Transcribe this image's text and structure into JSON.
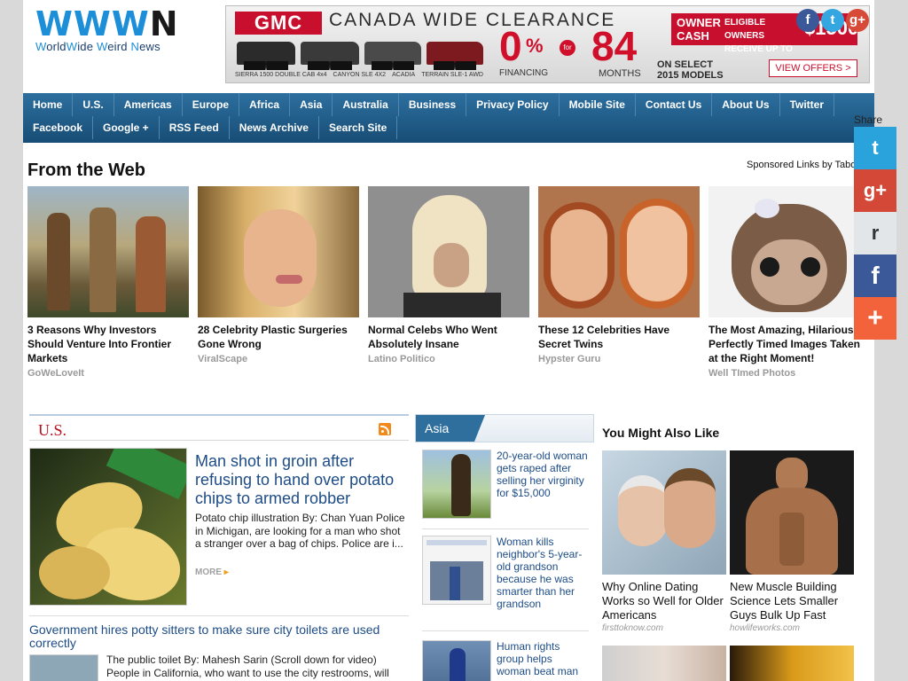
{
  "logo": {
    "mark": "WWW",
    "mark_n": "N",
    "tagline_words": [
      "W",
      "orld",
      "W",
      "ide ",
      "W",
      "eird ",
      "N",
      "ews"
    ],
    "tagline": "WorldWide Weird News"
  },
  "ad": {
    "brand": "GMC",
    "headline": "CANADA WIDE CLEARANCE",
    "models": [
      "SIERRA 1500 DOUBLE CAB 4x4",
      "CANYON SLE 4X2",
      "ACADIA",
      "TERRAIN SLE-1 AWD"
    ],
    "rate": "0",
    "rate_unit": "%",
    "financing": "FINANCING",
    "for": "for",
    "months_num": "84",
    "months": "MONTHS",
    "owner_cash": "OWNER CASH",
    "eligible": "ELIGIBLE OWNERS RECEIVE UP TO",
    "amount": "$1500",
    "on_select": "ON SELECT",
    "model_year": "2015 MODELS",
    "cta": "VIEW OFFERS >"
  },
  "header_social": {
    "facebook": "f",
    "twitter": "t",
    "googleplus": "g+"
  },
  "nav": {
    "row1": [
      "Home",
      "U.S.",
      "Americas",
      "Europe",
      "Africa",
      "Asia",
      "Australia",
      "Business",
      "Privacy Policy",
      "Mobile Site",
      "Contact Us",
      "About Us",
      "Twitter"
    ],
    "row2": [
      "Facebook",
      "Google +",
      "RSS Feed",
      "News Archive",
      "Search Site"
    ]
  },
  "from_the_web": {
    "title": "From the Web",
    "sponsored": "Sponsored Links by Taboola",
    "cards": [
      {
        "caption": "3 Reasons Why Investors Should Venture Into Frontier Markets",
        "source": "GoWeLoveIt"
      },
      {
        "caption": "28 Celebrity Plastic Surgeries Gone Wrong",
        "source": "ViralScape"
      },
      {
        "caption": "Normal Celebs Who Went Absolutely Insane",
        "source": "Latino Politico"
      },
      {
        "caption": "These 12 Celebrities Have Secret Twins",
        "source": "Hypster Guru"
      },
      {
        "caption": "The Most Amazing, Hilarious, Perfectly Timed Images Taken at the Right Moment!",
        "source": "Well TImed Photos"
      }
    ]
  },
  "us_section": {
    "title": "U.S.",
    "story1": {
      "headline": "Man shot in groin after refusing to hand over potato chips to armed robber",
      "body": "Potato chip illustration By: Chan Yuan Police in Michigan, are looking for a man who shot a stranger over a bag of chips. Police are i...",
      "more": "MORE"
    },
    "story2": {
      "headline": "Government hires potty sitters to make sure city toilets are used correctly",
      "body": "The public toilet By: Mahesh Sarin (Scroll down for video) People in California, who want to use the city restrooms, will"
    }
  },
  "asia_section": {
    "title": "Asia",
    "items": [
      {
        "text": "20-year-old woman gets raped after selling her virginity for $15,000"
      },
      {
        "text": "Woman kills neighbor's 5-year-old grandson because he was smarter than her grandson"
      },
      {
        "text": "Human rights group helps woman beat man"
      }
    ]
  },
  "ymal": {
    "title": "You Might Also Like",
    "cards": [
      {
        "caption": "Why Online Dating Works so Well for Older Americans",
        "source": "firsttoknow.com"
      },
      {
        "caption": "New Muscle Building Science Lets Smaller Guys Bulk Up Fast",
        "source": "howlifeworks.com"
      }
    ]
  },
  "share": {
    "label": "Share",
    "twitter": "t",
    "googleplus": "g+",
    "reddit": "r",
    "facebook": "f",
    "more": "+"
  },
  "colors": {
    "brand_blue": "#1d8ed8",
    "nav_blue": "#1f5f8e",
    "link_blue": "#1d4c86",
    "us_red": "#b8121e",
    "gmc_red": "#c8102e"
  }
}
